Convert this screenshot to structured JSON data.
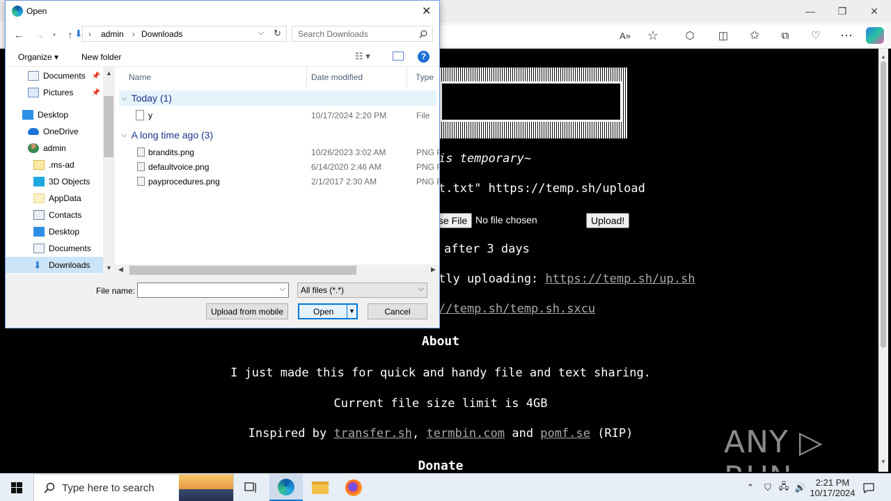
{
  "browser": {
    "min_icon": "—",
    "restore_icon": "❐",
    "close_icon": "✕",
    "read_aloud_icon": "A»",
    "favorite_icon": "☆",
    "extensions_icon": "⬡",
    "split_icon": "◫",
    "favorites_icon": "✩",
    "collections_icon": "⧉",
    "performance_icon": "♡",
    "more_icon": "⋯"
  },
  "page": {
    "tagline": "is temporary~",
    "curl_line": "t.txt\" https://temp.sh/upload",
    "choose_file": "se File",
    "no_file": "No file chosen",
    "upload": "Upload!",
    "expire": "after 3 days",
    "script_prefix": "tly uploading: ",
    "script_link": "https://temp.sh/up.sh",
    "sxcu_link": "//temp.sh/temp.sh.sxcu",
    "about_heading": "About",
    "about_text": "I just made this for quick and handy file and text sharing.",
    "limit_text": "Current file size limit is 4GB",
    "inspired_prefix": "Inspired by ",
    "link1": "transfer.sh",
    "sep1": ", ",
    "link2": "termbin.com",
    "and_text": " and ",
    "link3": "pomf.se",
    "rip": " (RIP)",
    "donate_heading": "Donate",
    "watermark": "ANY ▷ RUN"
  },
  "dialog": {
    "title": "Open",
    "close_glyph": "✕",
    "breadcrumb": [
      "admin",
      "Downloads"
    ],
    "breadcrumb_sep": "›",
    "search_placeholder": "Search Downloads",
    "organize": "Organize ▾",
    "new_folder": "New folder",
    "help_glyph": "?",
    "nav_items": [
      {
        "label": "Documents",
        "pinned": true
      },
      {
        "label": "Pictures",
        "pinned": true
      },
      {
        "label": "Desktop"
      },
      {
        "label": "OneDrive"
      },
      {
        "label": "admin"
      },
      {
        "label": ".ms-ad"
      },
      {
        "label": "3D Objects"
      },
      {
        "label": "AppData"
      },
      {
        "label": "Contacts"
      },
      {
        "label": "Desktop"
      },
      {
        "label": "Documents"
      },
      {
        "label": "Downloads"
      }
    ],
    "columns": {
      "name": "Name",
      "date": "Date modified",
      "type": "Type"
    },
    "groups": [
      {
        "label": "Today (1)"
      },
      {
        "label": "A long time ago (3)"
      }
    ],
    "files": [
      {
        "name": "y",
        "date": "10/17/2024 2:20 PM",
        "type": "File"
      },
      {
        "name": "brandits.png",
        "date": "10/26/2023 3:02 AM",
        "type": "PNG File"
      },
      {
        "name": "defaultvoice.png",
        "date": "6/14/2020 2:46 AM",
        "type": "PNG File"
      },
      {
        "name": "payprocedures.png",
        "date": "2/1/2017 2:30 AM",
        "type": "PNG File"
      }
    ],
    "file_name_label": "File name:",
    "file_name_value": "",
    "file_type": "All files (*.*)",
    "upload_mobile": "Upload from mobile",
    "open": "Open",
    "cancel": "Cancel"
  },
  "taskbar": {
    "search_placeholder": "Type here to search",
    "time": "2:21 PM",
    "date": "10/17/2024"
  },
  "colors": {
    "accent": "#0078d7",
    "selection": "#cce4f7",
    "group_text": "#1e3287",
    "page_bg": "#000000"
  }
}
